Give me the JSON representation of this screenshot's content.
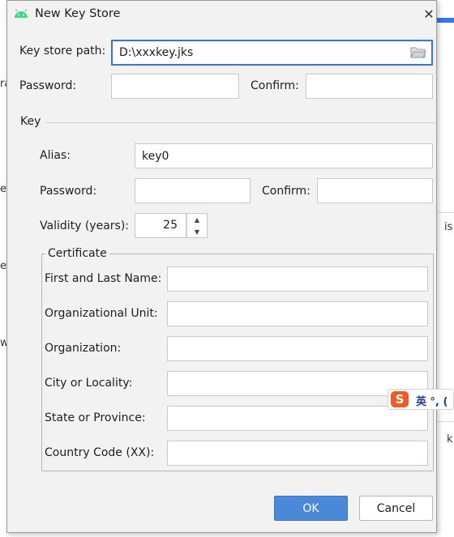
{
  "window": {
    "title": "New Key Store",
    "close_glyph": "✕"
  },
  "keystore": {
    "path_label": "Key store path:",
    "path_value": "D:\\xxxkey.jks",
    "password_label": "Password:",
    "confirm_label": "Confirm:"
  },
  "key": {
    "section_label": "Key",
    "alias_label": "Alias:",
    "alias_value": "key0",
    "password_label": "Password:",
    "confirm_label": "Confirm:",
    "validity_label": "Validity (years):",
    "validity_value": "25"
  },
  "certificate": {
    "group_label": "Certificate",
    "fields": [
      {
        "label": "First and Last Name:"
      },
      {
        "label": "Organizational Unit:"
      },
      {
        "label": "Organization:"
      },
      {
        "label": "City or Locality:"
      },
      {
        "label": "State or Province:"
      },
      {
        "label": "Country Code (XX):"
      }
    ]
  },
  "buttons": {
    "ok": "OK",
    "cancel": "Cancel"
  },
  "ime": {
    "logo": "S",
    "text": "英 °, ("
  },
  "background": {
    "fragments": [
      "ra",
      "e",
      "e",
      "w",
      "is",
      "k"
    ]
  },
  "colors": {
    "accent": "#3574f0",
    "ok_button": "#4a88d8",
    "android_green": "#3ddc84",
    "ime_orange": "#f05a23"
  }
}
